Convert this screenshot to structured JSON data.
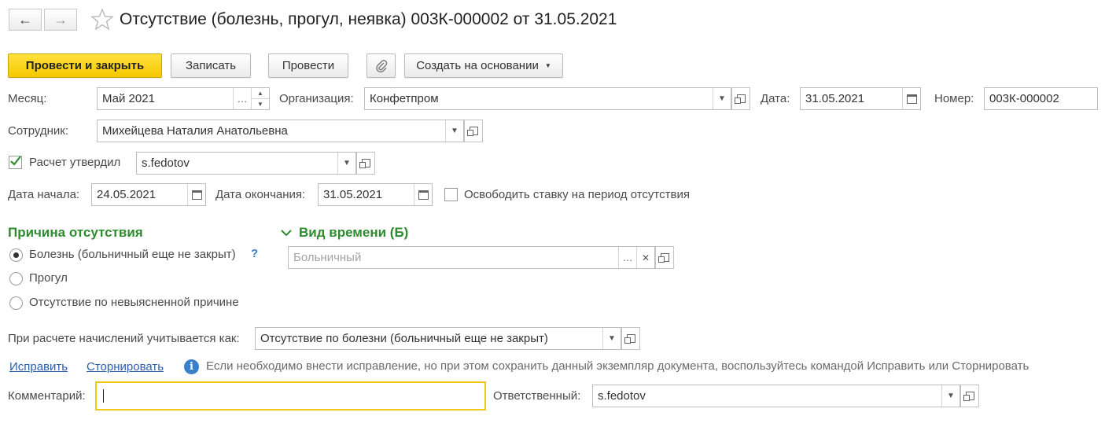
{
  "header": {
    "back_icon": "arrow-left-icon",
    "forward_icon": "arrow-right-icon",
    "favorite_icon": "star-icon",
    "title": "Отсутствие (болезнь, прогул, неявка) 003К-000002 от 31.05.2021"
  },
  "toolbar": {
    "post_close": "Провести и закрыть",
    "save": "Записать",
    "post": "Провести",
    "attach_icon": "paperclip-icon",
    "create_based": "Создать на основании"
  },
  "form": {
    "month_label": "Месяц:",
    "month_value": "Май 2021",
    "org_label": "Организация:",
    "org_value": "Конфетпром",
    "date_label": "Дата:",
    "date_value": "31.05.2021",
    "number_label": "Номер:",
    "number_value": "003К-000002",
    "employee_label": "Сотрудник:",
    "employee_value": "Михейцева Наталия Анатольевна",
    "approved_label": "Расчет утвердил",
    "approved_checked": true,
    "approved_value": "s.fedotov",
    "start_label": "Дата начала:",
    "start_value": "24.05.2021",
    "end_label": "Дата окончания:",
    "end_value": "31.05.2021",
    "release_label": "Освободить ставку на период отсутствия",
    "release_checked": false
  },
  "reason": {
    "title": "Причина отсутствия",
    "options": [
      {
        "label": "Болезнь (больничный еще не закрыт)",
        "selected": true
      },
      {
        "label": "Прогул",
        "selected": false
      },
      {
        "label": "Отсутствие по невыясненной причине",
        "selected": false
      }
    ],
    "help": "?"
  },
  "time_kind": {
    "title": "Вид времени (Б)",
    "placeholder": "Больничный"
  },
  "accrual": {
    "label": "При расчете начислений учитывается как:",
    "value": "Отсутствие по болезни (больничный еще не закрыт)"
  },
  "actions": {
    "fix": "Исправить",
    "storno": "Сторнировать",
    "info": "Если необходимо внести исправление, но при этом сохранить данный экземпляр документа, воспользуйтесь командой Исправить или Сторнировать"
  },
  "footer": {
    "comment_label": "Комментарий:",
    "comment_value": "",
    "responsible_label": "Ответственный:",
    "responsible_value": "s.fedotov"
  },
  "colors": {
    "primary": "#f5c800",
    "section": "#2e8b2e",
    "link": "#2a5db0",
    "focus": "#f2c811"
  }
}
